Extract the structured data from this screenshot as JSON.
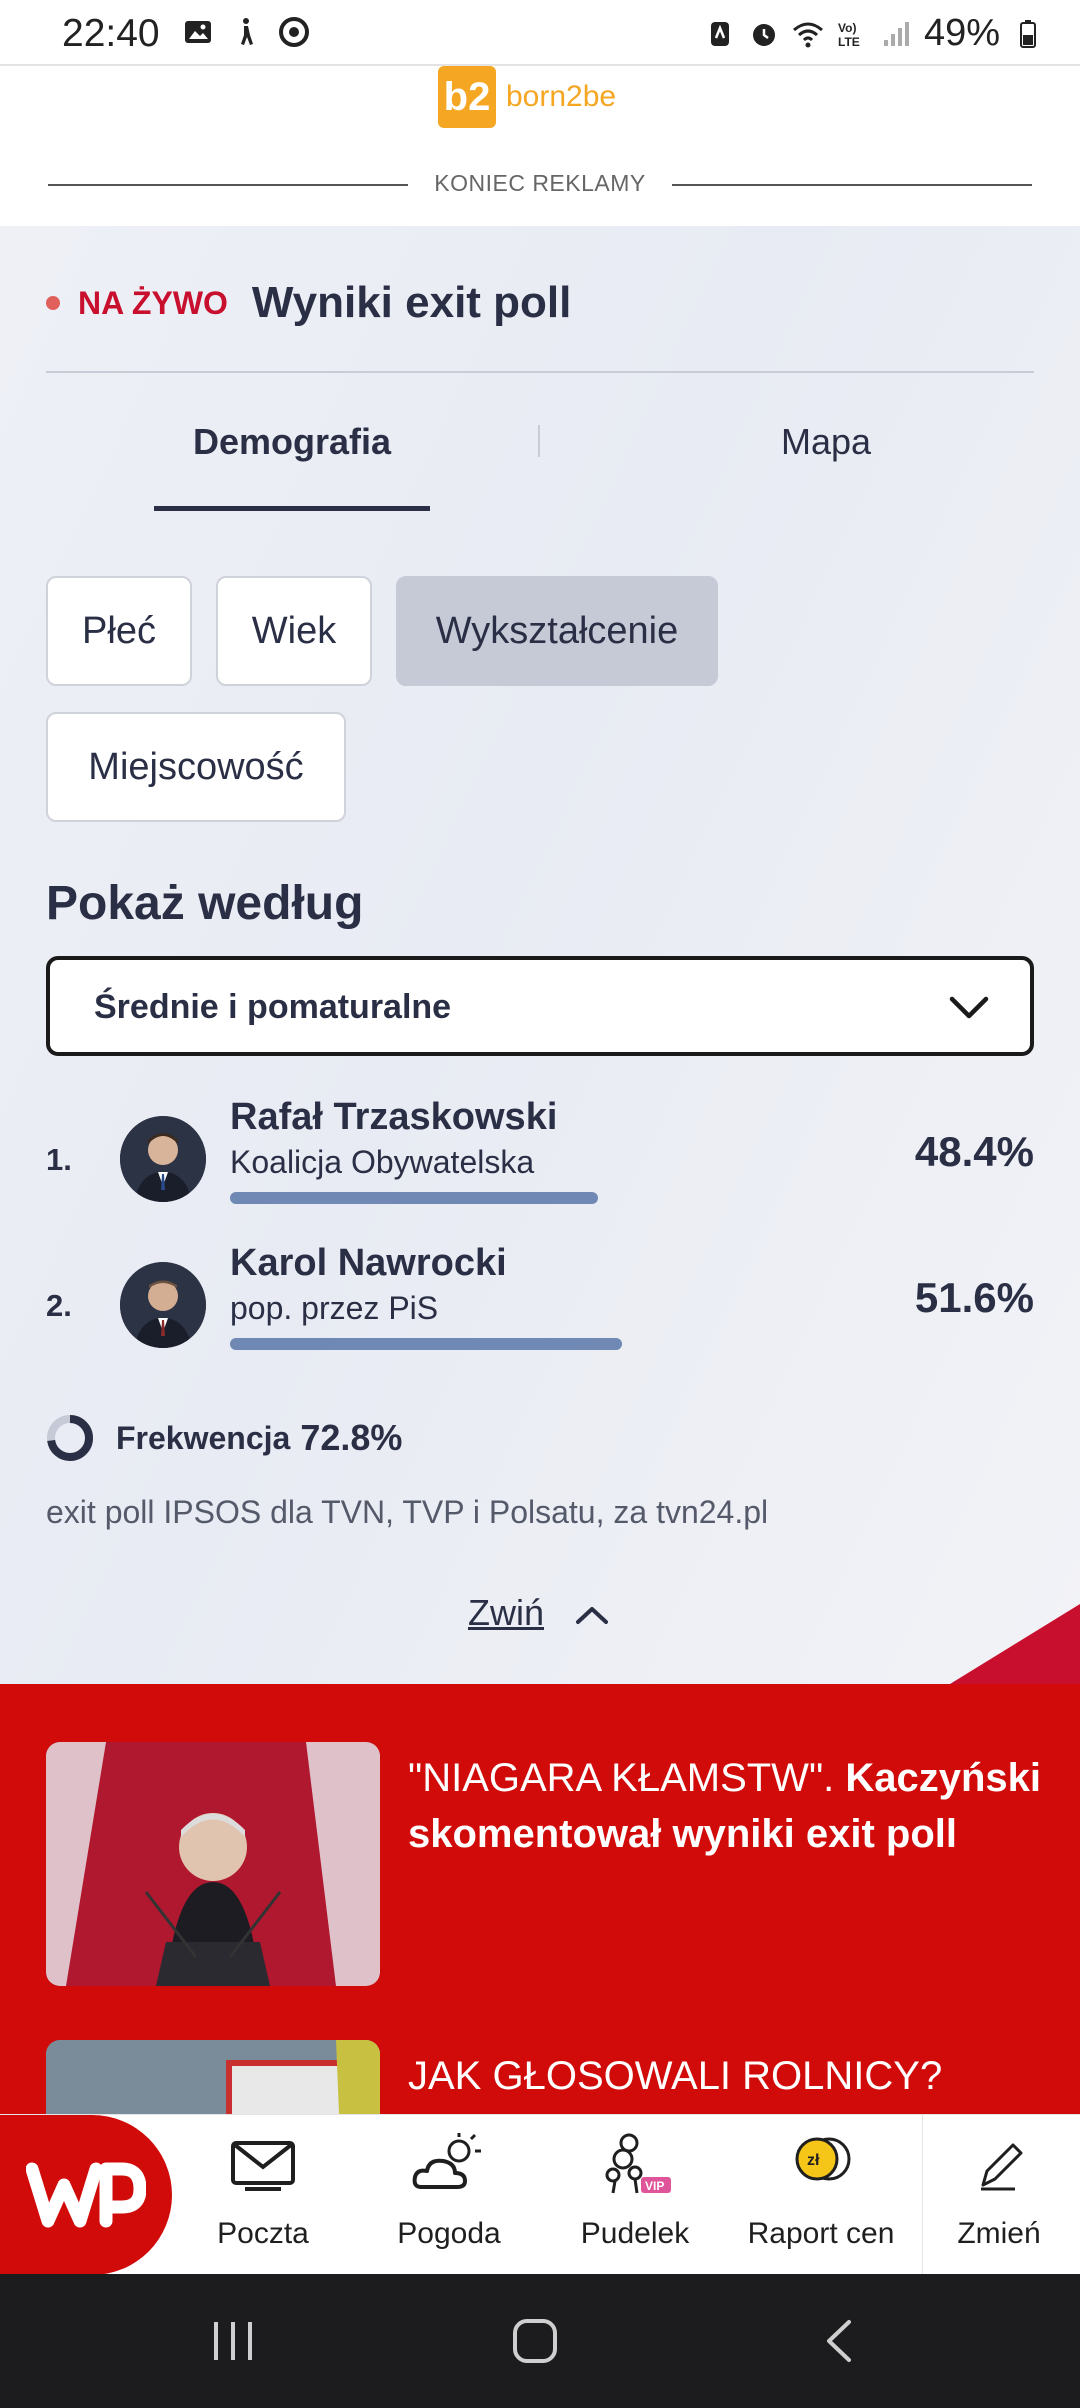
{
  "status_bar": {
    "time": "22:40",
    "battery": "49%",
    "icons": [
      "image-icon",
      "accessibility-icon",
      "chrome-icon",
      "nfc-icon",
      "alarm-icon",
      "wifi-icon",
      "volte-icon",
      "signal-icon",
      "battery-icon"
    ]
  },
  "ad": {
    "brand_mark": "b2",
    "brand_text": "born2be",
    "end_label": "KONIEC REKLAMY"
  },
  "widget": {
    "live_label": "NA ŻYWO",
    "title": "Wyniki exit poll",
    "tabs": [
      {
        "label": "Demografia",
        "active": true
      },
      {
        "label": "Mapa",
        "active": false
      }
    ],
    "filters": [
      {
        "label": "Płeć",
        "selected": false
      },
      {
        "label": "Wiek",
        "selected": false
      },
      {
        "label": "Wykształcenie",
        "selected": true
      },
      {
        "label": "Miejscowość",
        "selected": false
      }
    ],
    "show_by_label": "Pokaż według",
    "dropdown_value": "Średnie i pomaturalne",
    "candidates": [
      {
        "rank": "1.",
        "name": "Rafał Trzaskowski",
        "party": "Koalicja Obywatelska",
        "percent": "48.4%",
        "bar_value": 48.4
      },
      {
        "rank": "2.",
        "name": "Karol Nawrocki",
        "party": "pop. przez PiS",
        "percent": "51.6%",
        "bar_value": 51.6
      }
    ],
    "turnout_label": "Frekwencja",
    "turnout_value": "72.8%",
    "turnout_fraction": 0.728,
    "source": "exit poll IPSOS dla TVN, TVP i Polsatu, za tvn24.pl",
    "collapse_label": "Zwiń"
  },
  "news": [
    {
      "quote": "\"NIAGARA KŁAMSTW\".",
      "rest": " Kaczyński skomentował wyniki exit poll"
    },
    {
      "quote": "JAK GŁOSOWALI ROLNICY?",
      "rest": ""
    }
  ],
  "bottom_nav": {
    "items": [
      {
        "label": "Poczta",
        "icon": "mail-icon"
      },
      {
        "label": "Pogoda",
        "icon": "weather-icon"
      },
      {
        "label": "Pudelek",
        "icon": "pudelek-icon"
      },
      {
        "label": "Raport cen",
        "icon": "coins-icon"
      },
      {
        "label": "Zmień",
        "icon": "pencil-icon"
      }
    ]
  },
  "colors": {
    "brand_red": "#d10a0a",
    "live_red": "#c8102e",
    "bar_blue": "#7088b4",
    "text_dark": "#2a2f45",
    "ad_orange": "#f5a623"
  }
}
